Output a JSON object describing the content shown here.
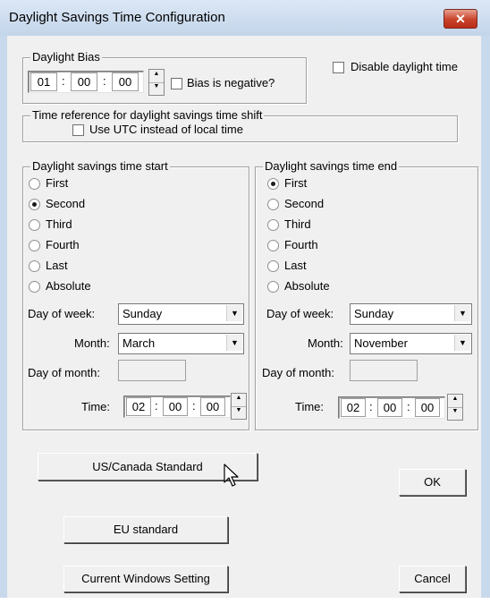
{
  "window": {
    "title": "Daylight Savings Time Configuration",
    "close_glyph": "✕"
  },
  "bias": {
    "legend": "Daylight Bias",
    "hours": "01",
    "minutes": "00",
    "seconds": "00",
    "negative_label": "Bias is negative?"
  },
  "disable": {
    "label": "Disable daylight time"
  },
  "timeref": {
    "legend": "Time reference for daylight savings time shift",
    "utc_label": "Use UTC instead of local time"
  },
  "start": {
    "legend": "Daylight savings time start",
    "options": [
      "First",
      "Second",
      "Third",
      "Fourth",
      "Last",
      "Absolute"
    ],
    "selected": "Second",
    "day_of_week_label": "Day of week:",
    "day_of_week": "Sunday",
    "month_label": "Month:",
    "month": "March",
    "day_of_month_label": "Day of month:",
    "day_of_month": "",
    "time_label": "Time:",
    "hours": "02",
    "minutes": "00",
    "seconds": "00"
  },
  "end": {
    "legend": "Daylight savings time end",
    "options": [
      "First",
      "Second",
      "Third",
      "Fourth",
      "Last",
      "Absolute"
    ],
    "selected": "First",
    "day_of_week_label": "Day of week:",
    "day_of_week": "Sunday",
    "month_label": "Month:",
    "month": "November",
    "day_of_month_label": "Day of month:",
    "day_of_month": "",
    "time_label": "Time:",
    "hours": "02",
    "minutes": "00",
    "seconds": "00"
  },
  "buttons": {
    "us_canada": "US/Canada Standard",
    "eu": "EU standard",
    "current_windows": "Current Windows Setting",
    "ok": "OK",
    "cancel": "Cancel"
  },
  "colors": {
    "titlebar": "#c3d5ea",
    "close": "#c8422a",
    "dialog_bg": "#f0f0f0"
  },
  "icons": {
    "cursor": "arrow-cursor-icon",
    "spin_up": "▲",
    "spin_down": "▼",
    "dropdown": "▼"
  }
}
